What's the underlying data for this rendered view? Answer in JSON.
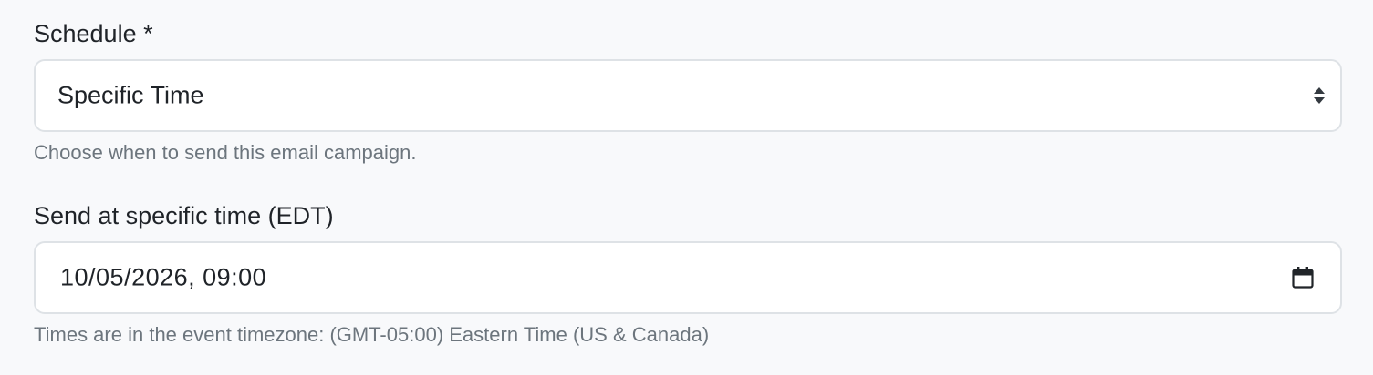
{
  "schedule": {
    "label": "Schedule *",
    "selected": "Specific Time",
    "help": "Choose when to send this email campaign.",
    "icon": "select-arrows-icon"
  },
  "send_time": {
    "label": "Send at specific time (EDT)",
    "value": "10/05/2026, 09:00",
    "help": "Times are in the event timezone: (GMT-05:00) Eastern Time (US & Canada)",
    "icon": "calendar-icon"
  },
  "colors": {
    "background": "#f8f9fb",
    "border": "#dee2e6",
    "label": "#1f2328",
    "help": "#6c757d"
  }
}
